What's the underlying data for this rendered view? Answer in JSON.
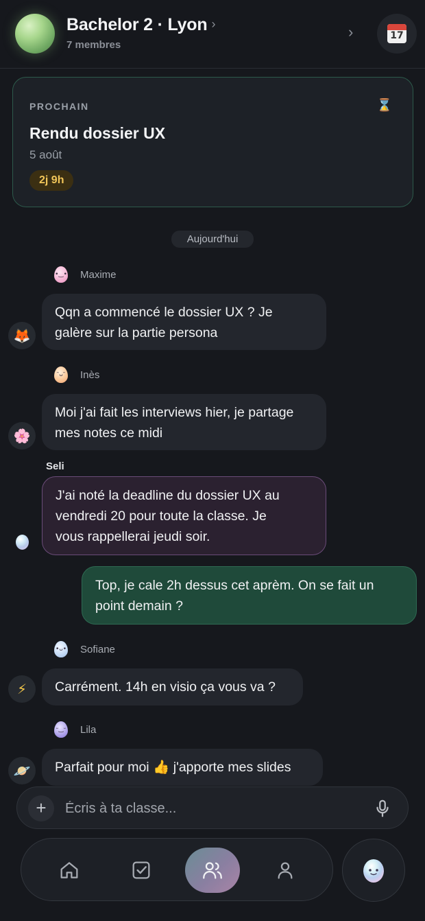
{
  "header": {
    "title": "Bachelor 2 · Lyon",
    "title_chevron": "›",
    "subtitle": "7 membres",
    "chevron": "›",
    "calendar_icon": "calendar-icon",
    "calendar_day": "17"
  },
  "next_card": {
    "label": "PROCHAIN",
    "icon": "hourglass-icon",
    "title": "Rendu dossier UX",
    "date": "5 août",
    "countdown": "2j 9h"
  },
  "date_separator": "Aujourd'hui",
  "messages": [
    {
      "sender": "Maxime",
      "avatar": "fox-icon",
      "text_lines": [
        "Qqn a commencé le dossier UX ? Je",
        "galère sur la partie persona"
      ]
    },
    {
      "sender": "Inès",
      "avatar": "flower-icon",
      "text_lines": [
        "Moi j'ai fait les interviews hier, je partage",
        "mes notes ce midi"
      ]
    },
    {
      "sender": "Seli",
      "avatar": "seli-orb",
      "text_lines": [
        "J'ai noté la deadline du dossier UX au",
        "vendredi 20 pour toute la classe. Je",
        "vous rappellerai jeudi soir."
      ]
    },
    {
      "sender": "me",
      "text_lines": [
        "Top, je cale 2h dessus cet aprèm. On se fait un",
        "point demain ?"
      ]
    },
    {
      "sender": "Sofiane",
      "avatar": "lightning-icon",
      "text_lines": [
        "Carrément. 14h en visio ça vous va ?"
      ]
    },
    {
      "sender": "Lila",
      "avatar": "planet-icon",
      "text_lines": [
        "Parfait pour moi 👍 j'apporte mes slides"
      ]
    }
  ],
  "composer": {
    "placeholder": "Écris à ta classe...",
    "plus_icon": "plus-icon",
    "mic_icon": "microphone-icon"
  },
  "nav": {
    "items": [
      "home-icon",
      "tasks-icon",
      "people-icon",
      "profile-icon"
    ],
    "active": "people-icon",
    "assistant": "assistant-orb-icon"
  },
  "colors": {
    "accent_green": "#2d5a4b",
    "countdown_text": "#f2c659",
    "seli_border": "#6b4c79",
    "my_bubble": "#1f4a3a"
  }
}
